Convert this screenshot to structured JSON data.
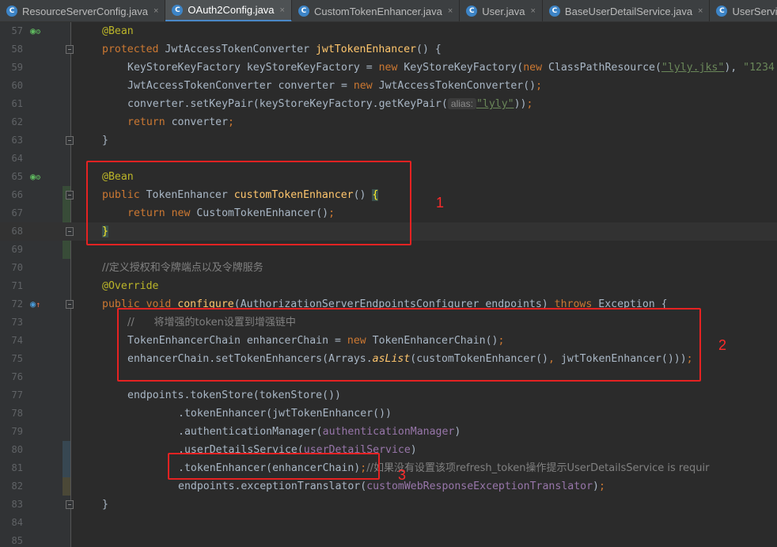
{
  "tabs": [
    {
      "label": "ResourceServerConfig.java",
      "icon": "class-icon",
      "active": false,
      "close": "×"
    },
    {
      "label": "OAuth2Config.java",
      "icon": "class-icon",
      "active": true,
      "close": "×"
    },
    {
      "label": "CustomTokenEnhancer.java",
      "icon": "class-icon",
      "active": false,
      "close": "×"
    },
    {
      "label": "User.java",
      "icon": "class-icon",
      "active": false,
      "close": "×"
    },
    {
      "label": "BaseUserDetailService.java",
      "icon": "class-icon",
      "active": false,
      "close": "×"
    },
    {
      "label": "UserServiceI",
      "icon": "class-icon",
      "active": false,
      "close": ""
    }
  ],
  "class_icon_letter": "C",
  "line_numbers": [
    "57",
    "58",
    "59",
    "60",
    "61",
    "62",
    "63",
    "64",
    "65",
    "66",
    "67",
    "68",
    "69",
    "70",
    "71",
    "72",
    "73",
    "74",
    "75",
    "76",
    "77",
    "78",
    "79",
    "80",
    "81",
    "82",
    "83",
    "84",
    "85"
  ],
  "code": {
    "l57": {
      "ann": "@Bean"
    },
    "l58": {
      "kw": "protected ",
      "t1": "JwtAccessTokenConverter ",
      "fn": "jwtTokenEnhancer",
      "t2": "() {"
    },
    "l59": {
      "t1": "KeyStoreKeyFactory keyStoreKeyFactory = ",
      "kw1": "new ",
      "t2": "KeyStoreKeyFactory(",
      "kw2": "new ",
      "t3": "ClassPathResource(",
      "s1": "\"lyly.jks\"",
      "t4": "), ",
      "s2": "\"1234"
    },
    "l60": {
      "t1": "JwtAccessTokenConverter converter = ",
      "kw": "new ",
      "t2": "JwtAccessTokenConverter()",
      "kw2": ";"
    },
    "l61": {
      "t1": "converter.setKeyPair(keyStoreKeyFactory.getKeyPair(",
      "hint": "alias:",
      "s": "\"lyly\"",
      "t2": "))",
      "kw": ";"
    },
    "l62": {
      "kw": "return ",
      "t1": "converter",
      "kw2": ";"
    },
    "l63": {
      "t1": "}"
    },
    "l65": {
      "ann": "@Bean"
    },
    "l66": {
      "kw": "public ",
      "t1": "TokenEnhancer ",
      "fn": "customTokenEnhancer",
      "t2": "() ",
      "br": "{"
    },
    "l67": {
      "kw": "return new ",
      "t1": "CustomTokenEnhancer()",
      "kw2": ";"
    },
    "l68": {
      "br": "}"
    },
    "l70": {
      "cmt": "//定义授权和令牌端点以及令牌服务"
    },
    "l71": {
      "ann": "@Override"
    },
    "l72": {
      "kw": "public void ",
      "fn": "configure",
      "t1": "(AuthorizationServerEndpointsConfigurer endpoints) ",
      "kw2": "throws ",
      "t2": "Exception {"
    },
    "l73": {
      "cmt": "//      将增强的token设置到增强链中"
    },
    "l74": {
      "t1": "TokenEnhancerChain enhancerChain = ",
      "kw": "new ",
      "t2": "TokenEnhancerChain()",
      "kw2": ";"
    },
    "l75": {
      "t1": "enhancerChain.setTokenEnhancers(Arrays.",
      "it": "asList",
      "t2": "(customTokenEnhancer()",
      "kw": ", ",
      "t3": "jwtTokenEnhancer()))",
      "kw2": ";"
    },
    "l77": {
      "t1": "endpoints.tokenStore(tokenStore())"
    },
    "l78": {
      "t1": ".tokenEnhancer(jwtTokenEnhancer())"
    },
    "l79": {
      "t1": ".authenticationManager(",
      "fld": "authenticationManager",
      "t2": ")"
    },
    "l80": {
      "t1": ".userDetailsService(",
      "fld": "userDetailService",
      "t2": ")"
    },
    "l81": {
      "t1": ".tokenEnhancer(enhancerChain)",
      "kw": ";",
      "cmt": "//如果没有设置该项refresh_token操作提示UserDetailsService is requir"
    },
    "l82": {
      "t1": "endpoints.exceptionTranslator(",
      "fld": "customWebResponseExceptionTranslator",
      "t2": ")",
      "kw": ";"
    },
    "l83": {
      "t1": "}"
    }
  },
  "annotations": {
    "box1": "1",
    "box2": "2",
    "box3": "3"
  },
  "colors": {
    "keyword": "#cc7832",
    "annotation": "#bbb529",
    "method": "#ffc66d",
    "string": "#6a8759",
    "comment": "#808080",
    "field": "#9876aa",
    "highlight_box": "#e52222"
  }
}
